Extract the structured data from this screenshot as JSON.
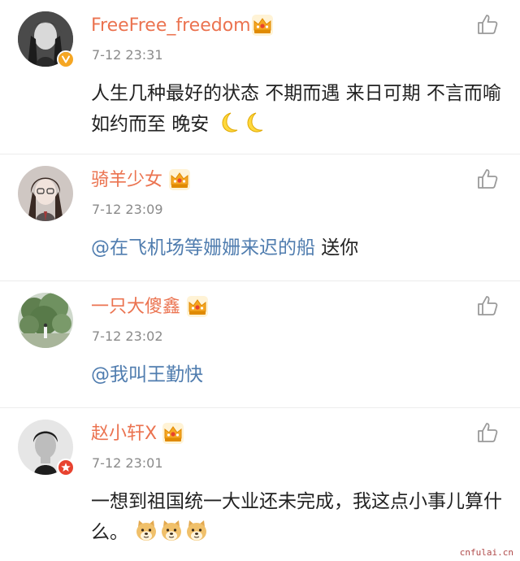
{
  "colors": {
    "username": "#eb7350",
    "mention": "#507daf",
    "timestamp": "#8a8a8a",
    "text": "#222222",
    "crown": "#f5a623",
    "divider": "#ececec"
  },
  "comments": [
    {
      "username": "FreeFree_freedom",
      "timestamp": "7-12 23:31",
      "text": "人生几种最好的状态  不期而遇  来日可期  不言而喻  如约而至  晚安",
      "emojis": [
        "moon-emoji",
        "moon-emoji"
      ],
      "badge": "verified-v-badge"
    },
    {
      "username": "骑羊少女",
      "timestamp": "7-12 23:09",
      "mention": "@在飞机场等姗姗来迟的船",
      "text": " 送你"
    },
    {
      "username": "一只大傻鑫",
      "timestamp": "7-12 23:02",
      "mention": "@我叫王勤快",
      "text": ""
    },
    {
      "username": "赵小轩X",
      "timestamp": "7-12 23:01",
      "text": "一想到祖国统一大业还未完成，我这点小事儿算什么。",
      "emojis": [
        "doge-emoji",
        "doge-emoji",
        "doge-emoji"
      ],
      "badge": "star-badge"
    }
  ],
  "watermark": "cnfulai.cn"
}
